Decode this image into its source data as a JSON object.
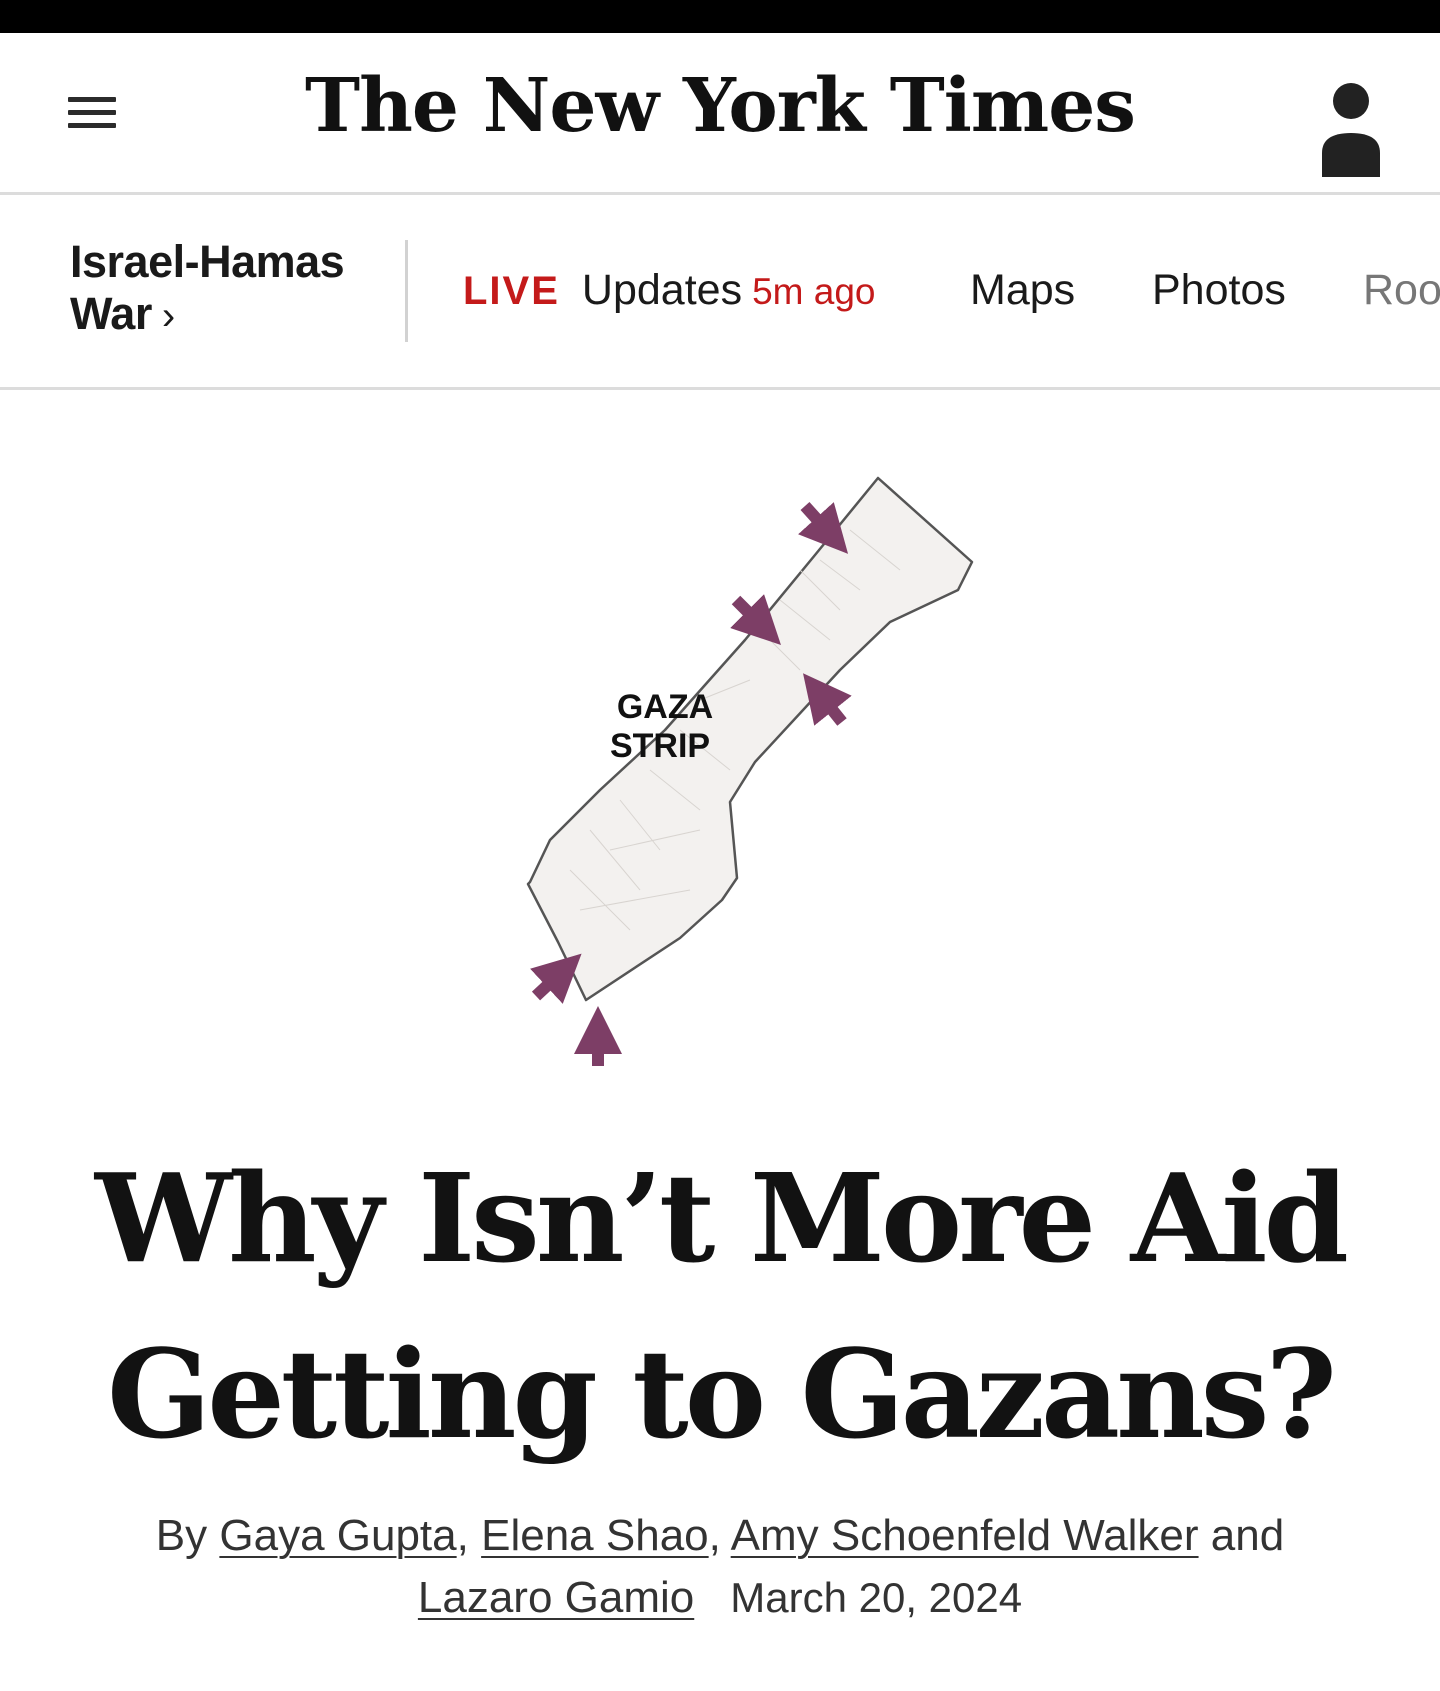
{
  "masthead": {
    "logo_text": "The New York Times",
    "menu_icon": "hamburger-menu-icon",
    "user_icon": "user-account-icon"
  },
  "section_bar": {
    "section_title_line1": "Israel-Hamas",
    "section_title_line2": "War",
    "section_chevron": "›",
    "live_label": "LIVE",
    "updates_label": "Updates",
    "updated_ago": "5m ago",
    "nav_items": [
      "Maps",
      "Photos",
      "Roo"
    ]
  },
  "map": {
    "label_line1": "GAZA",
    "label_line2": "STRIP",
    "arrow_color": "#7d3e66",
    "land_color": "#f3f1ef"
  },
  "article": {
    "headline_line1": "Why Isn’t More Aid",
    "headline_line2": "Getting to Gazans?",
    "by_prefix": "By",
    "authors": [
      "Gaya Gupta",
      "Elena Shao",
      "Amy Schoenfeld Walker",
      "Lazaro Gamio"
    ],
    "sep1": ",",
    "sep2": ",",
    "and_word": "and",
    "date": "March 20, 2024"
  },
  "colors": {
    "live_red": "#c41a1a",
    "divider_gray": "#dcdcdc"
  }
}
